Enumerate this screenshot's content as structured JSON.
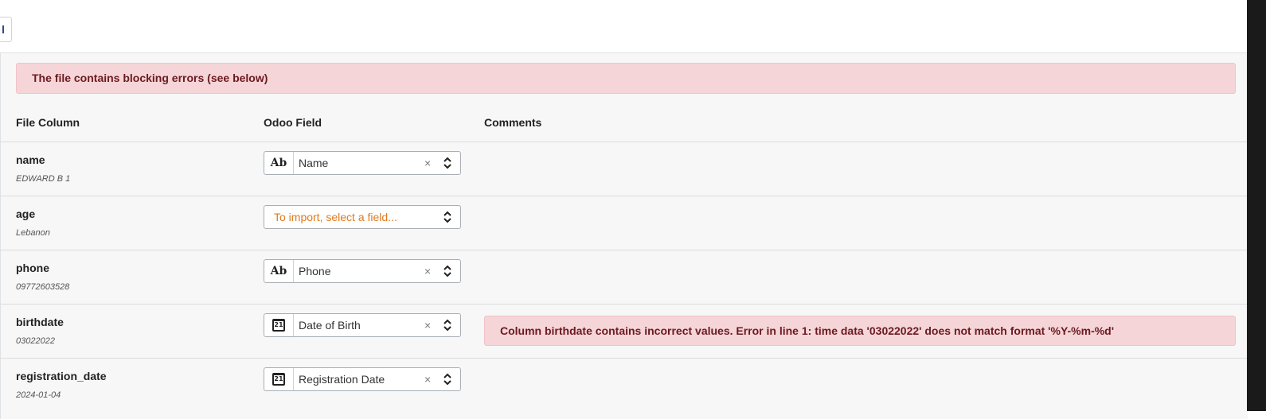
{
  "alert": {
    "text": "The file contains blocking errors (see below)"
  },
  "headers": {
    "file_column": "File Column",
    "odoo_field": "Odoo Field",
    "comments": "Comments"
  },
  "rows": [
    {
      "column": "name",
      "sample": "EDWARD B 1",
      "field_type": "text",
      "field": "Name",
      "clear": "×"
    },
    {
      "column": "age",
      "sample": "Lebanon",
      "field_type": "none",
      "placeholder": "To import, select a field..."
    },
    {
      "column": "phone",
      "sample": "09772603528",
      "field_type": "text",
      "field": "Phone",
      "clear": "×"
    },
    {
      "column": "birthdate",
      "sample": "03022022",
      "field_type": "date",
      "field": "Date of Birth",
      "clear": "×",
      "error": "Column birthdate contains incorrect values. Error in line 1: time data '03022022' does not match format '%Y-%m-%d'"
    },
    {
      "column": "registration_date",
      "sample": "2024-01-04",
      "field_type": "date",
      "field": "Registration Date",
      "clear": "×"
    }
  ],
  "icons": {
    "text_icon": "Ab",
    "date_icon": "21"
  },
  "colors": {
    "alert_bg": "#f5d5d8",
    "alert_text": "#6b1a21",
    "placeholder": "#e07a1f"
  }
}
